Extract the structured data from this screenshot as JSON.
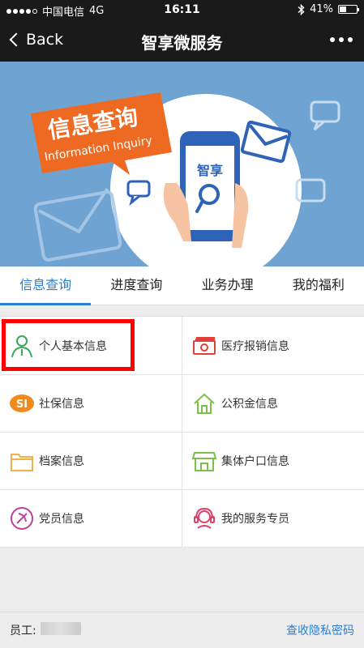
{
  "status_bar": {
    "carrier": "中国电信",
    "network": "4G",
    "time": "16:11",
    "battery": "41%",
    "battery_level": 0.41
  },
  "nav": {
    "back_label": "Back",
    "title": "智享微服务"
  },
  "banner": {
    "heading": "信息查询",
    "subheading": "Information Inquiry",
    "phone_text": "智享"
  },
  "tabs": [
    {
      "label": "信息查询",
      "active": true
    },
    {
      "label": "进度查询",
      "active": false
    },
    {
      "label": "业务办理",
      "active": false
    },
    {
      "label": "我的福利",
      "active": false
    }
  ],
  "grid_items": [
    {
      "label": "个人基本信息",
      "icon": "person-icon",
      "color": "#3aaa5a"
    },
    {
      "label": "医疗报销信息",
      "icon": "money-icon",
      "color": "#e0403a"
    },
    {
      "label": "社保信息",
      "icon": "social-security-icon",
      "color": "#f08a1c"
    },
    {
      "label": "公积金信息",
      "icon": "house-icon",
      "color": "#7cc04a"
    },
    {
      "label": "档案信息",
      "icon": "folder-icon",
      "color": "#f0b04a"
    },
    {
      "label": "集体户口信息",
      "icon": "shop-icon",
      "color": "#7cc04a"
    },
    {
      "label": "党员信息",
      "icon": "party-emblem-icon",
      "color": "#c0409a"
    },
    {
      "label": "我的服务专员",
      "icon": "headset-icon",
      "color": "#e0406a"
    }
  ],
  "footer": {
    "employee_label": "员工:",
    "privacy_link": "查收隐私密码"
  },
  "colors": {
    "accent": "#2a7fd4",
    "banner_bg": "#6fa3d2",
    "banner_label": "#ee6a22",
    "highlight": "#ff0000"
  }
}
